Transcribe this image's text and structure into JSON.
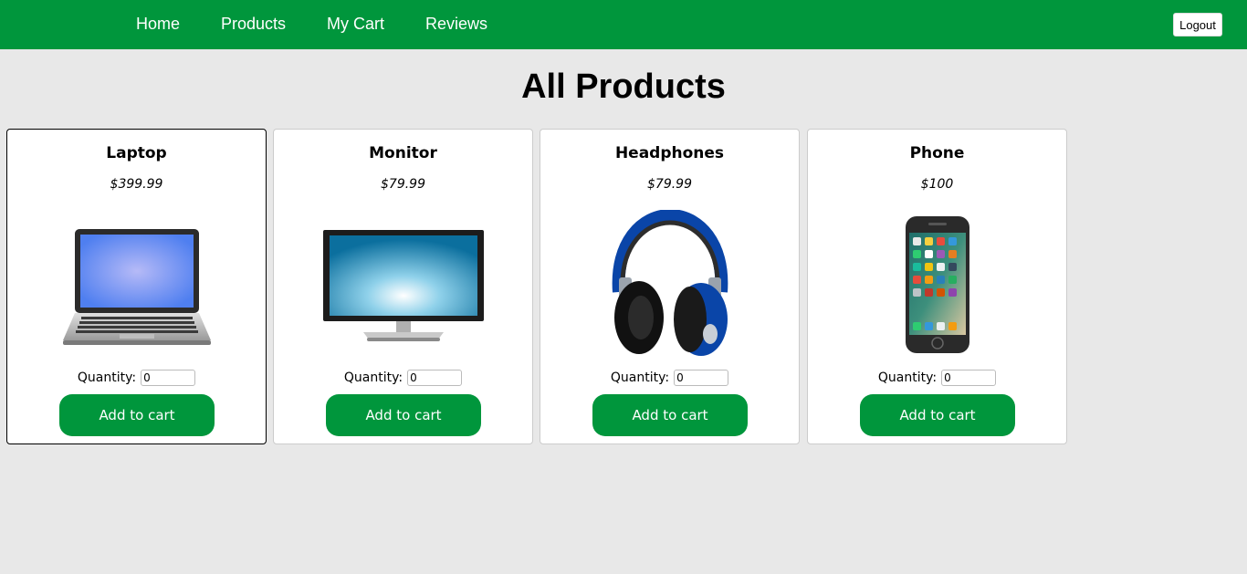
{
  "nav": {
    "links": [
      "Home",
      "Products",
      "My Cart",
      "Reviews"
    ],
    "logout_label": "Logout",
    "color": "#00963c"
  },
  "page": {
    "title": "All Products"
  },
  "quantity_label": "Quantity:",
  "add_to_cart_label": "Add to cart",
  "products": [
    {
      "name": "Laptop",
      "price": "$399.99",
      "quantity": "0",
      "icon": "laptop-image"
    },
    {
      "name": "Monitor",
      "price": "$79.99",
      "quantity": "0",
      "icon": "monitor-image"
    },
    {
      "name": "Headphones",
      "price": "$79.99",
      "quantity": "0",
      "icon": "headphones-image"
    },
    {
      "name": "Phone",
      "price": "$100",
      "quantity": "0",
      "icon": "phone-image"
    }
  ]
}
